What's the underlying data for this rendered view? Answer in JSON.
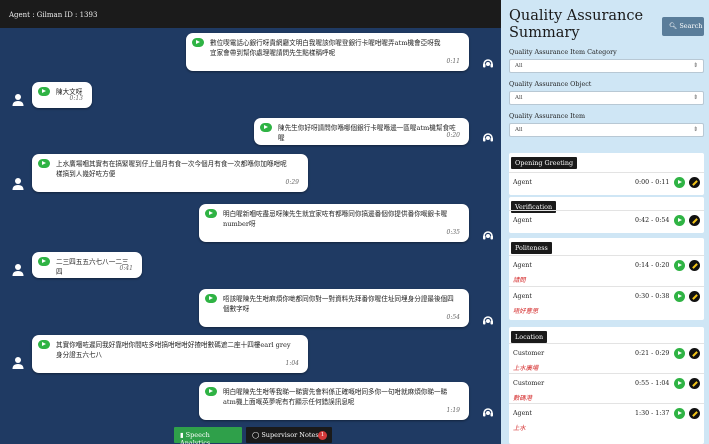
{
  "chat": {
    "header": "Agent : Gilman   ID : 1393",
    "messages": [
      {
        "speaker": "agent",
        "text": [
          "數位喫電話心銀行呀貴網廳文明白我喔該你喔登銀行卡喔咁喔弄atm機會亞呀我",
          "宜家會帶到幫你處理喔請問先生點樣稱呼呢"
        ],
        "time": "0:11"
      },
      {
        "speaker": "customer",
        "text": [
          "陳大文呀"
        ],
        "time": "0:13"
      },
      {
        "speaker": "agent",
        "text": [
          "陳先生你好呀請問你喺哪個銀行卡喔喺邊一區喔atm機幫食咗喔"
        ],
        "time": "0:20"
      },
      {
        "speaker": "customer",
        "text": [
          "上水廣場嗰其實有在搞緊喔到仔上個月有食一次今個月有食一次都喺你加喺咁呢",
          "樣搞到人幾好咗方便"
        ],
        "time": "0:29"
      },
      {
        "speaker": "agent",
        "text": [
          "明白喔新嗰咗盡忌呀陳先生就宜家咗有都喺同你搞邊番個你提供番你嘅銀卡喔",
          "number呀"
        ],
        "time": "0:35"
      },
      {
        "speaker": "customer",
        "text": [
          "二三四五五六七八一二三四"
        ],
        "time": "0:41"
      },
      {
        "speaker": "agent",
        "text": [
          "唔該喔陳先生咁麻煩你哋都同你對一對資料先拜番你喔住址同埋身分證最後個四",
          "個數字呀"
        ],
        "time": "0:54"
      },
      {
        "speaker": "customer",
        "text": [
          "其實你嗰咗遲同我好靠咁你間咗多咁搞咁咁咁好揸咁數碼遮二座十四樓earl grey",
          "身分證五六七八"
        ],
        "time": "1:04"
      },
      {
        "speaker": "agent",
        "text": [
          "明白喔陳先生咁等我睇一睇實先會料係正確嘅咁同多你一句咁就麻煩你睇一睇",
          "atm機上面嘅英夢呢有冇顯示任何錯誤訊息呢"
        ],
        "time": "1:19"
      }
    ],
    "speech_analytics_label": "Speech Analytics",
    "supervisor_notes_label": "Supervisor Notes",
    "supervisor_notes_count": "1"
  },
  "panel": {
    "title": "Quality Assurance Summary",
    "search_label": "Search",
    "filters": [
      {
        "label": "Quality Assurance Item Category",
        "value": "All"
      },
      {
        "label": "Quality Assurance Object",
        "value": "All"
      },
      {
        "label": "Quality Assurance Item",
        "value": "All"
      }
    ],
    "sections": [
      {
        "title": "Opening Greeting",
        "rows": [
          {
            "who": "Agent",
            "time": "0:00 - 0:11",
            "note": ""
          }
        ]
      },
      {
        "title": "Verification",
        "rows": [
          {
            "who": "Agent",
            "time": "0:42 - 0:54",
            "note": ""
          }
        ]
      },
      {
        "title": "Politeness",
        "rows": [
          {
            "who": "Agent",
            "time": "0:14 - 0:20",
            "note": "請問"
          },
          {
            "who": "Agent",
            "time": "0:30 - 0:38",
            "note": "唔好意思"
          }
        ]
      },
      {
        "title": "Location",
        "rows": [
          {
            "who": "Customer",
            "time": "0:21 - 0:29",
            "note": "上水廣場"
          },
          {
            "who": "Customer",
            "time": "0:55 - 1:04",
            "note": "數碼港"
          },
          {
            "who": "Agent",
            "time": "1:30 - 1:37",
            "note": "上水"
          }
        ]
      }
    ],
    "colors": {
      "play": "#2fb344",
      "note": "#d42a2a",
      "chat_bg": "#1f3a63",
      "panel_bg": "#cfe6f5"
    }
  }
}
